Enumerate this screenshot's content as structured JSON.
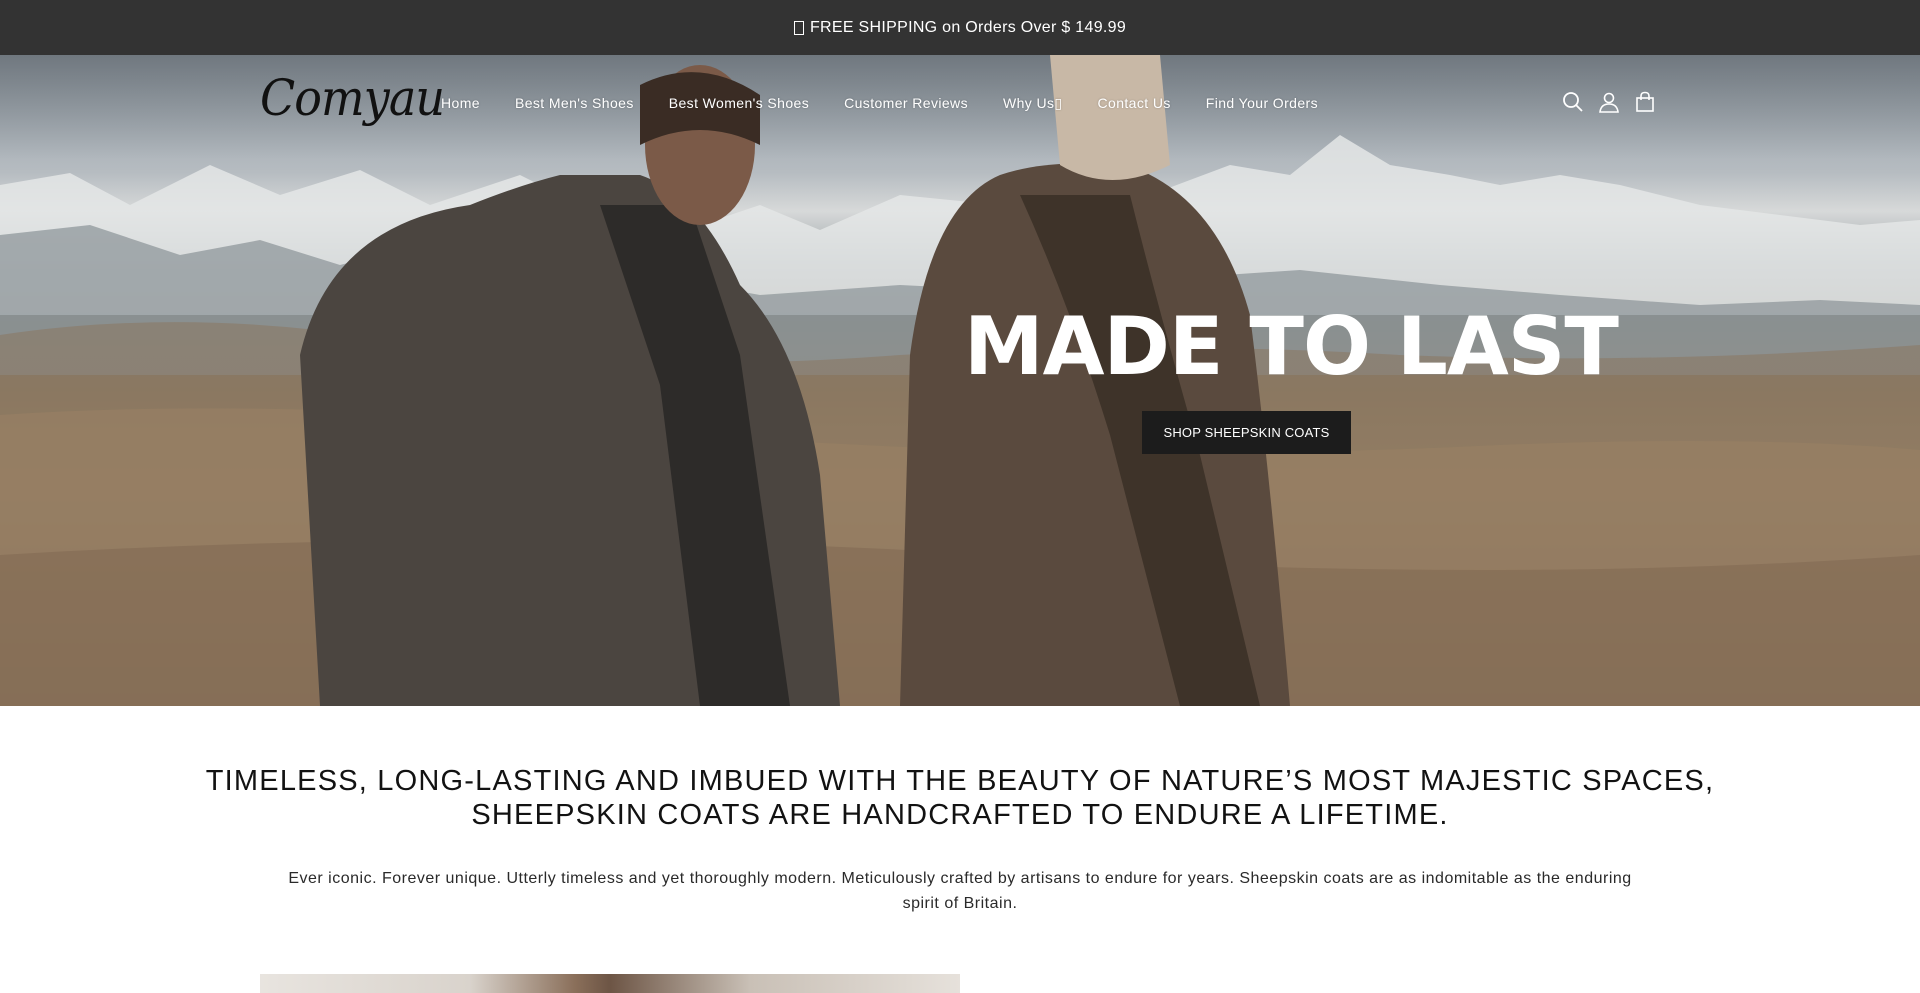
{
  "announcement": {
    "text": "FREE SHIPPING on Orders Over $ 149.99",
    "icon": "missing-glyph-icon"
  },
  "header": {
    "logo_text": "Comyau",
    "nav": [
      {
        "label": "Home"
      },
      {
        "label": "Best Men's Shoes"
      },
      {
        "label": "Best Women's Shoes"
      },
      {
        "label": "Customer Reviews"
      },
      {
        "label": "Why Us▯"
      },
      {
        "label": "Contact Us"
      },
      {
        "label": "Find Your Orders"
      }
    ],
    "icons": [
      "search-icon",
      "account-icon",
      "cart-icon"
    ]
  },
  "hero": {
    "title": "MADE TO LAST",
    "button_label": "SHOP SHEEPSKIN COATS",
    "image": "man-and-woman-in-sheepskin-coats-mountain-landscape"
  },
  "intro": {
    "tagline_line1": "TIMELESS, LONG-LASTING AND IMBUED WITH THE BEAUTY OF NATURE’S MOST MAJESTIC SPACES,",
    "tagline_line2": "SHEEPSKIN COATS ARE HANDCRAFTED TO ENDURE A LIFETIME.",
    "description": "Ever iconic. Forever unique. Utterly timeless and yet thoroughly modern. Meticulously crafted by artisans to endure for years. Sheepskin coats are as indomitable as the enduring spirit of Britain."
  },
  "colors": {
    "announcement_bg": "#333333",
    "button_bg": "#1c1c1c",
    "text": "#121212"
  }
}
